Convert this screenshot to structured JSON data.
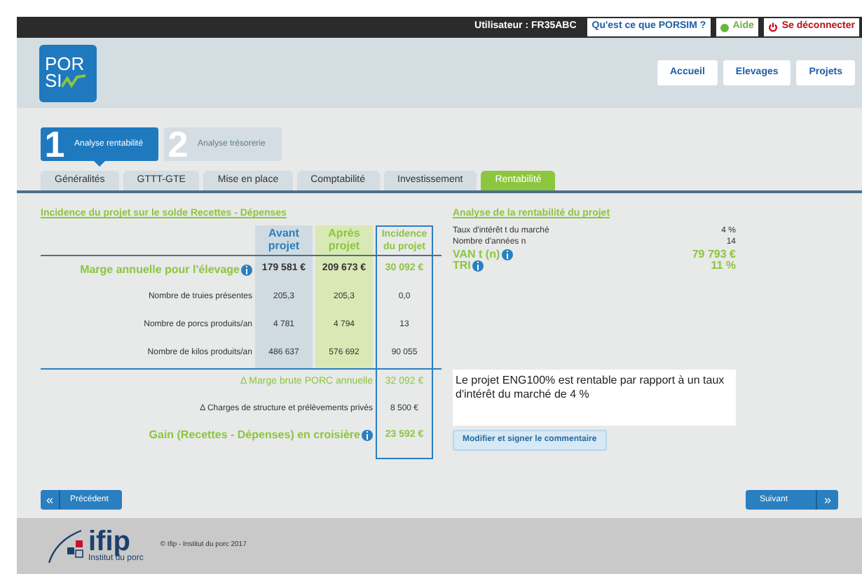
{
  "top_bar": {
    "user": "Utilisateur : FR35ABC",
    "links": [
      {
        "label": "Qu'est ce que PORSIM ?",
        "kind": "plain"
      },
      {
        "label": "Aide",
        "kind": "help"
      },
      {
        "label": "Se déconnecter",
        "kind": "logout"
      }
    ]
  },
  "logo": {
    "line1": "POR",
    "line2": "SI"
  },
  "nav": [
    "Accueil",
    "Elevages",
    "Projets"
  ],
  "steps": [
    {
      "number": "1",
      "label": "Analyse rentabilité",
      "selected": true
    },
    {
      "number": "2",
      "label": "Analyse trésorerie",
      "selected": false
    }
  ],
  "tabs": [
    {
      "label": "Généralités",
      "selected": false
    },
    {
      "label": "GTTT-GTE",
      "selected": false
    },
    {
      "label": "Mise en place",
      "selected": false
    },
    {
      "label": "Comptabilité",
      "selected": false
    },
    {
      "label": "Investissement",
      "selected": false
    },
    {
      "label": "Rentabilité",
      "selected": true
    }
  ],
  "incidence": {
    "title": "Incidence du projet sur le solde Recettes - Dépenses",
    "columns": [
      "Avant projet",
      "Après projet",
      "Incidence du projet"
    ],
    "rows": [
      {
        "label": "Marge annuelle pour l'élevage",
        "kind": "highlight",
        "info": true,
        "values": [
          "179 581 €",
          "209 673 €",
          "30 092 €"
        ]
      },
      {
        "label": "Nombre de truies présentes",
        "kind": "normal",
        "info": false,
        "values": [
          "205,3",
          "205,3",
          "0,0"
        ]
      },
      {
        "label": "Nombre de porcs produits/an",
        "kind": "normal",
        "info": false,
        "values": [
          "4 781",
          "4 794",
          "13"
        ]
      },
      {
        "label": "Nombre de kilos produits/an",
        "kind": "normal",
        "info": false,
        "values": [
          "486 637",
          "576 692",
          "90 055"
        ]
      }
    ],
    "summary": [
      {
        "label": "Δ Marge brute PORC annuelle",
        "value": "32 092 €",
        "kind": "highlight",
        "info": false
      },
      {
        "label": "Δ Charges de structure et prélèvements privés",
        "value": "8 500 €",
        "kind": "normal",
        "info": false
      },
      {
        "label": "Gain (Recettes - Dépenses) en croisière",
        "value": "23 592 €",
        "kind": "total",
        "info": true
      }
    ]
  },
  "analysis": {
    "title": "Analyse de la rentabilité du projet",
    "rows": [
      {
        "label": "Taux d'intérêt t du marché",
        "value": "4 %",
        "kind": "normal",
        "info": false
      },
      {
        "label": "Nombre d'années n",
        "value": "14",
        "kind": "normal",
        "info": false
      },
      {
        "label": "VAN t (n)",
        "value": "79 793 €",
        "kind": "highlight",
        "info": true
      },
      {
        "label": "TRI",
        "value": "11 %",
        "kind": "highlight",
        "info": true
      }
    ]
  },
  "comment": {
    "text": "Le projet ENG100% est rentable par rapport à un taux d'intérêt du marché de 4 %",
    "button": "Modifier et signer le commentaire"
  },
  "prev_button": {
    "icon": "«",
    "label": "Précédent"
  },
  "next_button": {
    "icon": "»",
    "label": "Suivant"
  },
  "footer": {
    "logo": "ifip",
    "logo_sub": "Institut du porc",
    "copyright": "© Ifip - Institut du porc 2017"
  }
}
